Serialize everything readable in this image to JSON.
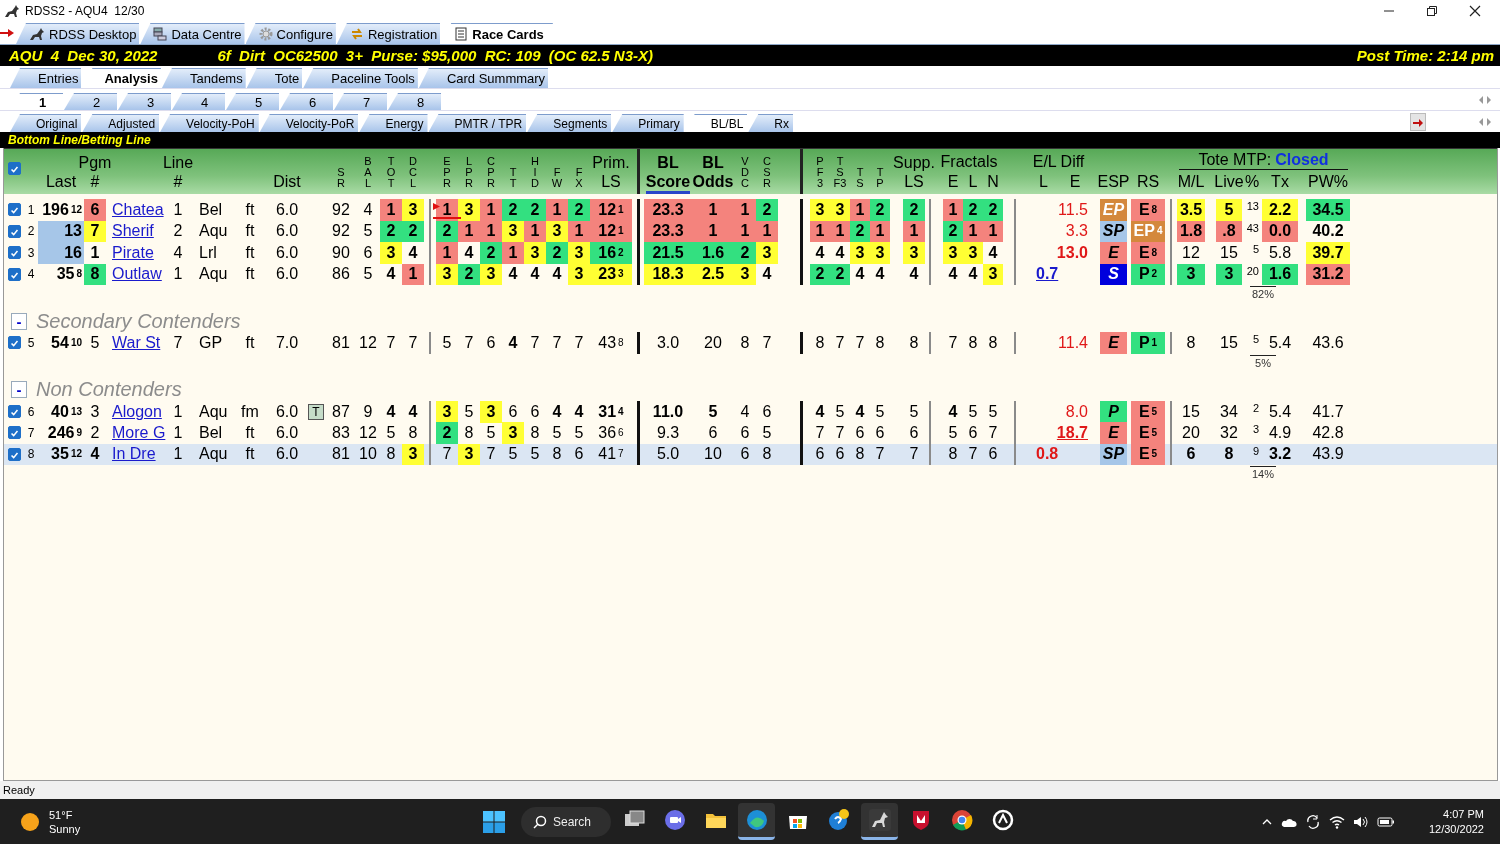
{
  "window": {
    "title": "RDSS2 - AQU4  12/30"
  },
  "app_tabs": [
    {
      "label": "RDSS Desktop",
      "selected": false
    },
    {
      "label": "Data Centre",
      "selected": false
    },
    {
      "label": "Configure",
      "selected": false
    },
    {
      "label": "Registration",
      "selected": false
    },
    {
      "label": "Race Cards",
      "selected": true
    }
  ],
  "race_bar": {
    "race": "AQU  4  Dec 30, 2022",
    "conditions": "6f  Dirt  OC62500  3+  Purse: $95,000  RC: 109  (OC 62.5 N3-X)",
    "post_time": "Post Time: 2:14 pm"
  },
  "view_tabs": [
    {
      "label": "Entries",
      "selected": false
    },
    {
      "label": "Analysis",
      "selected": true
    },
    {
      "label": "Tandems",
      "selected": false
    },
    {
      "label": "Tote",
      "selected": false
    },
    {
      "label": "Paceline Tools",
      "selected": false
    },
    {
      "label": "Card Summmary",
      "selected": false
    }
  ],
  "race_tabs": [
    {
      "label": "1",
      "selected": true
    },
    {
      "label": "2",
      "selected": false
    },
    {
      "label": "3",
      "selected": false
    },
    {
      "label": "4",
      "selected": false
    },
    {
      "label": "5",
      "selected": false
    },
    {
      "label": "6",
      "selected": false
    },
    {
      "label": "7",
      "selected": false
    },
    {
      "label": "8",
      "selected": false
    }
  ],
  "report_tabs": [
    {
      "label": "Original",
      "selected": false
    },
    {
      "label": "Adjusted",
      "selected": false
    },
    {
      "label": "Velocity-PoH",
      "selected": false
    },
    {
      "label": "Velocity-PoR",
      "selected": false
    },
    {
      "label": "Energy",
      "selected": false
    },
    {
      "label": "PMTR / TPR",
      "selected": false
    },
    {
      "label": "Segments",
      "selected": false
    },
    {
      "label": "Primary",
      "selected": false
    },
    {
      "label": "BL/BL",
      "selected": true
    },
    {
      "label": "Rx",
      "selected": false
    }
  ],
  "caption": "Bottom Line/Betting Line",
  "table": {
    "header": {
      "checked": true,
      "columns": [
        null,
        {
          "label": "Last",
          "sorted": false
        },
        {
          "label": "Pgm\n#",
          "sorted": false
        },
        null,
        {
          "label": "Line\n#",
          "sorted": false
        },
        null,
        null,
        {
          "label": "Dist",
          "sorted": false
        },
        null,
        {
          "label": "S\nR",
          "sorted": false
        },
        {
          "label": "B\nA\nL",
          "sorted": false
        },
        {
          "label": "T\nO\nT",
          "sorted": false
        },
        {
          "label": "D\nC\nL",
          "sorted": false
        },
        {
          "label": "E\nP\nR",
          "sorted": false
        },
        {
          "label": "L\nP\nR",
          "sorted": false
        },
        {
          "label": "C\nP\nR",
          "sorted": false
        },
        {
          "label": "T\nT",
          "sorted": false
        },
        {
          "label": "H\nI\nD",
          "sorted": false
        },
        {
          "label": "F\nW",
          "sorted": false
        },
        {
          "label": "F\nX",
          "sorted": false
        },
        {
          "label": "Prim.\nLS",
          "sorted": false
        },
        {
          "label": "BL\nScore",
          "sorted": true,
          "bold": true
        },
        {
          "label": "BL\nOdds",
          "sorted": false,
          "bold": true
        },
        {
          "label": "V\nD\nC",
          "sorted": false
        },
        {
          "label": "C\nS\nR",
          "sorted": false
        },
        {
          "label": "P\nF\n3",
          "sorted": false
        },
        {
          "label": "T\nS\nF3",
          "sorted": false
        },
        {
          "label": "T\nS",
          "sorted": false
        },
        {
          "label": "T\nP",
          "sorted": false
        },
        {
          "label": "Supp.\nLS",
          "sorted": false
        },
        {
          "label": "E",
          "sorted": false
        },
        {
          "label": "L",
          "sorted": false
        },
        {
          "label": "N",
          "sorted": false
        },
        {
          "label": "L",
          "sorted": false
        },
        {
          "label": "E",
          "sorted": false
        },
        {
          "label": "ESP",
          "sorted": false
        },
        {
          "label": "RS",
          "sorted": false
        },
        {
          "label": "M/L",
          "sorted": false
        },
        {
          "label": "Live",
          "sorted": false
        },
        {
          "label": "%",
          "sorted": false
        },
        {
          "label": "Tx",
          "sorted": false
        },
        {
          "label": "PW%",
          "sorted": false
        }
      ],
      "groups": [
        {
          "label": "Fractals"
        },
        {
          "label": "E/L Diff"
        },
        {
          "label": "Tote MTP:",
          "status": "Closed"
        }
      ]
    },
    "groups": [
      {
        "total": "82%",
        "rows": [
          {
            "checked": true,
            "selected": false,
            "bold": true,
            "cells": [
              "1",
              {
                "text": "196",
                "sup": "12"
              },
              {
                "text": "6",
                "color": "#f4837d"
              },
              "Chatea",
              "1",
              "Bel",
              "ft",
              "6.0",
              null,
              "92",
              "4",
              {
                "text": "1",
                "color": "#f4837d"
              },
              {
                "text": "3",
                "color": "#ffff33"
              },
              {
                "text": "1",
                "color": "#f4837d",
                "flagged": true
              },
              {
                "text": "3",
                "color": "#ffff33"
              },
              {
                "text": "1",
                "color": "#f4837d"
              },
              {
                "text": "2",
                "color": "#33e080"
              },
              {
                "text": "2",
                "color": "#33e080"
              },
              {
                "text": "1",
                "color": "#f4837d"
              },
              {
                "text": "2",
                "color": "#33e080"
              },
              {
                "text": "12",
                "sup": "1",
                "color": "#f4837d"
              },
              {
                "text": "23.3",
                "color": "#f4837d"
              },
              {
                "text": "1",
                "color": "#f4837d"
              },
              {
                "text": "1",
                "color": "#f4837d"
              },
              {
                "text": "2",
                "color": "#33e080"
              },
              {
                "text": "3",
                "color": "#ffff33"
              },
              {
                "text": "3",
                "color": "#ffff33"
              },
              {
                "text": "1",
                "color": "#f4837d"
              },
              {
                "text": "2",
                "color": "#33e080"
              },
              {
                "text": "2",
                "color": "#33e080"
              },
              {
                "text": "1",
                "color": "#f4837d"
              },
              {
                "text": "2",
                "color": "#33e080"
              },
              {
                "text": "2",
                "color": "#33e080"
              },
              null,
              {
                "text": "11.5",
                "kind": "warn",
                "bold": false
              },
              {
                "text": "EP",
                "color": "#d4883c"
              },
              {
                "text": "E",
                "sup": "8",
                "color": "#f4837d"
              },
              {
                "text": "3.5",
                "color": "#ffff33"
              },
              {
                "text": "5",
                "color": "#ffff33"
              },
              "13",
              {
                "text": "2.2",
                "color": "#ffff33"
              },
              {
                "text": "34.5",
                "color": "#33e080"
              }
            ]
          },
          {
            "checked": true,
            "selected": false,
            "bold": true,
            "cells": [
              "2",
              {
                "text": "13",
                "color": "#a6c6e8"
              },
              {
                "text": "7",
                "color": "#ffff33"
              },
              "Sherif",
              "2",
              "Aqu",
              "ft",
              "6.0",
              null,
              "92",
              "5",
              {
                "text": "2",
                "color": "#33e080"
              },
              {
                "text": "2",
                "color": "#33e080"
              },
              {
                "text": "2",
                "color": "#33e080"
              },
              {
                "text": "1",
                "color": "#f4837d"
              },
              {
                "text": "1",
                "color": "#f4837d"
              },
              {
                "text": "3",
                "color": "#ffff33"
              },
              {
                "text": "1",
                "color": "#f4837d"
              },
              {
                "text": "3",
                "color": "#ffff33"
              },
              {
                "text": "1",
                "color": "#f4837d"
              },
              {
                "text": "12",
                "sup": "1",
                "color": "#f4837d"
              },
              {
                "text": "23.3",
                "color": "#f4837d"
              },
              {
                "text": "1",
                "color": "#f4837d"
              },
              {
                "text": "1",
                "color": "#f4837d"
              },
              {
                "text": "1",
                "color": "#f4837d"
              },
              {
                "text": "1",
                "color": "#f4837d"
              },
              {
                "text": "1",
                "color": "#f4837d"
              },
              {
                "text": "2",
                "color": "#33e080"
              },
              {
                "text": "1",
                "color": "#f4837d"
              },
              {
                "text": "1",
                "color": "#f4837d"
              },
              {
                "text": "2",
                "color": "#33e080"
              },
              {
                "text": "1",
                "color": "#f4837d"
              },
              {
                "text": "1",
                "color": "#f4837d"
              },
              null,
              {
                "text": "3.3",
                "kind": "warn",
                "bold": false
              },
              {
                "text": "SP",
                "color": "#a6c6e8"
              },
              {
                "text": "EP",
                "sup": "4",
                "color": "#d4883c"
              },
              {
                "text": "1.8",
                "color": "#f4837d"
              },
              {
                "text": ".8",
                "color": "#f4837d"
              },
              "43",
              {
                "text": "0.0",
                "color": "#f4837d"
              },
              "40.2"
            ]
          },
          {
            "checked": true,
            "selected": false,
            "bold": true,
            "cells": [
              "3",
              {
                "text": "16",
                "color": "#a6c6e8"
              },
              "1",
              "Pirate",
              "4",
              "Lrl",
              "ft",
              "6.0",
              null,
              "90",
              "6",
              {
                "text": "3",
                "color": "#ffff33"
              },
              "4",
              {
                "text": "1",
                "color": "#f4837d"
              },
              "4",
              {
                "text": "2",
                "color": "#33e080"
              },
              {
                "text": "1",
                "color": "#f4837d"
              },
              {
                "text": "3",
                "color": "#ffff33"
              },
              {
                "text": "2",
                "color": "#33e080"
              },
              {
                "text": "3",
                "color": "#ffff33"
              },
              {
                "text": "16",
                "sup": "2",
                "color": "#33e080"
              },
              {
                "text": "21.5",
                "color": "#33e080"
              },
              {
                "text": "1.6",
                "color": "#33e080"
              },
              {
                "text": "2",
                "color": "#33e080"
              },
              {
                "text": "3",
                "color": "#ffff33"
              },
              "4",
              "4",
              {
                "text": "3",
                "color": "#ffff33"
              },
              {
                "text": "3",
                "color": "#ffff33"
              },
              {
                "text": "3",
                "color": "#ffff33"
              },
              {
                "text": "3",
                "color": "#ffff33"
              },
              {
                "text": "3",
                "color": "#ffff33"
              },
              "4",
              null,
              {
                "text": "13.0",
                "kind": "warn"
              },
              {
                "text": "E",
                "color": "#f4837d"
              },
              {
                "text": "E",
                "sup": "8",
                "color": "#f4837d"
              },
              {
                "text": "12",
                "bold": false
              },
              {
                "text": "15",
                "bold": false
              },
              "5",
              {
                "text": "5.8",
                "bold": false
              },
              {
                "text": "39.7",
                "color": "#ffff33"
              }
            ]
          },
          {
            "checked": true,
            "selected": false,
            "bold": true,
            "cells": [
              "4",
              {
                "text": "35",
                "sup": "8"
              },
              {
                "text": "8",
                "color": "#33e080"
              },
              "Outlaw",
              "1",
              "Aqu",
              "ft",
              "6.0",
              null,
              "86",
              "5",
              "4",
              {
                "text": "1",
                "color": "#f4837d"
              },
              {
                "text": "3",
                "color": "#ffff33"
              },
              {
                "text": "2",
                "color": "#33e080"
              },
              {
                "text": "3",
                "color": "#ffff33"
              },
              "4",
              "4",
              "4",
              {
                "text": "3",
                "color": "#ffff33"
              },
              {
                "text": "23",
                "sup": "3",
                "color": "#ffff33"
              },
              {
                "text": "18.3",
                "color": "#ffff33"
              },
              {
                "text": "2.5",
                "color": "#ffff33"
              },
              {
                "text": "3",
                "color": "#ffff33"
              },
              "4",
              {
                "text": "2",
                "color": "#33e080"
              },
              {
                "text": "2",
                "color": "#33e080"
              },
              "4",
              "4",
              "4",
              "4",
              "4",
              {
                "text": "3",
                "color": "#ffff33"
              },
              {
                "text": "0.7",
                "kind": "link"
              },
              null,
              {
                "text": "S",
                "color": "#0000dd"
              },
              {
                "text": "P",
                "sup": "2",
                "color": "#33e080"
              },
              {
                "text": "3",
                "color": "#33e080"
              },
              {
                "text": "3",
                "color": "#33e080"
              },
              "20",
              {
                "text": "1.6",
                "color": "#33e080"
              },
              {
                "text": "31.2",
                "color": "#f4837d"
              }
            ]
          }
        ]
      },
      {
        "toggle": "-",
        "title": "Secondary Contenders",
        "total": "5%",
        "rows": [
          {
            "checked": true,
            "selected": false,
            "bold": false,
            "cells": [
              "5",
              {
                "text": "54",
                "sup": "10"
              },
              "5",
              "War St",
              "7",
              "GP",
              "ft",
              "7.0",
              null,
              "81",
              "12",
              "7",
              "7",
              "5",
              "7",
              "6",
              {
                "text": "4",
                "bold": true
              },
              "7",
              "7",
              "7",
              {
                "text": "43",
                "sup": "8"
              },
              "3.0",
              "20",
              "8",
              "7",
              "8",
              "7",
              "7",
              "8",
              "8",
              "7",
              "8",
              "8",
              null,
              {
                "text": "11.4",
                "kind": "warn"
              },
              {
                "text": "E",
                "color": "#f4837d"
              },
              {
                "text": "P",
                "sup": "1",
                "color": "#33e080"
              },
              "8",
              "15",
              "5",
              "5.4",
              "43.6"
            ]
          }
        ]
      },
      {
        "toggle": "-",
        "title": "Non Contenders",
        "total": "14%",
        "rows": [
          {
            "checked": true,
            "selected": false,
            "bold": false,
            "cells": [
              "6",
              {
                "text": "40",
                "sup": "13"
              },
              "3",
              "Alogon",
              "1",
              "Aqu",
              "fm",
              "6.0",
              "T",
              "87",
              "9",
              {
                "text": "4",
                "bold": true
              },
              {
                "text": "4",
                "bold": true
              },
              {
                "text": "3",
                "color": "#ffff33"
              },
              "5",
              {
                "text": "3",
                "color": "#ffff33"
              },
              "6",
              "6",
              {
                "text": "4",
                "bold": true
              },
              {
                "text": "4",
                "bold": true
              },
              {
                "text": "31",
                "sup": "4",
                "bold": true
              },
              {
                "text": "11.0",
                "bold": true
              },
              {
                "text": "5",
                "bold": true
              },
              "4",
              "6",
              {
                "text": "4",
                "bold": true
              },
              "5",
              {
                "text": "4",
                "bold": true
              },
              "5",
              "5",
              {
                "text": "4",
                "bold": true
              },
              "5",
              "5",
              null,
              {
                "text": "8.0",
                "kind": "warn"
              },
              {
                "text": "P",
                "color": "#33e080"
              },
              {
                "text": "E",
                "sup": "5",
                "color": "#f4837d"
              },
              "15",
              "34",
              "2",
              "5.4",
              "41.7"
            ]
          },
          {
            "checked": true,
            "selected": false,
            "bold": false,
            "cells": [
              "7",
              {
                "text": "246",
                "sup": "9"
              },
              "2",
              "More G",
              "1",
              "Bel",
              "ft",
              "6.0",
              null,
              "83",
              "12",
              "5",
              "8",
              {
                "text": "2",
                "color": "#33e080"
              },
              "8",
              "5",
              {
                "text": "3",
                "color": "#ffff33"
              },
              "8",
              "5",
              "5",
              {
                "text": "36",
                "sup": "6"
              },
              "9.3",
              "6",
              "6",
              "5",
              "7",
              "7",
              "6",
              "6",
              "6",
              "5",
              "6",
              "7",
              null,
              {
                "text": "18.7",
                "kind": "warn",
                "underline": true,
                "bold": true
              },
              {
                "text": "E",
                "color": "#f4837d"
              },
              {
                "text": "E",
                "sup": "5",
                "color": "#f4837d"
              },
              "20",
              "32",
              "3",
              "4.9",
              "42.8"
            ]
          },
          {
            "checked": true,
            "selected": true,
            "bold": false,
            "cells": [
              "8",
              {
                "text": "35",
                "sup": "12"
              },
              {
                "text": "4",
                "bold": true
              },
              "In Dre",
              "1",
              "Aqu",
              "ft",
              "6.0",
              null,
              "81",
              "10",
              "8",
              {
                "text": "3",
                "color": "#ffff33"
              },
              "7",
              {
                "text": "3",
                "color": "#ffff33"
              },
              "7",
              "5",
              "5",
              "8",
              "6",
              {
                "text": "41",
                "sup": "7"
              },
              "5.0",
              "10",
              "6",
              "8",
              "6",
              "6",
              "8",
              "7",
              "7",
              "8",
              "7",
              "6",
              {
                "text": "0.8",
                "kind": "warn",
                "bold": true
              },
              null,
              {
                "text": "SP",
                "color": "#a6c6e8"
              },
              {
                "text": "E",
                "sup": "5",
                "color": "#f4837d"
              },
              {
                "text": "6",
                "bold": true
              },
              {
                "text": "8",
                "bold": true
              },
              "9",
              {
                "text": "3.2",
                "bold": true
              },
              "43.9"
            ]
          }
        ]
      }
    ]
  },
  "status_bar": "Ready",
  "taskbar": {
    "weather": {
      "temperature": "51°F",
      "condition": "Sunny"
    },
    "search": "Search",
    "apps": [
      {
        "active": false
      },
      {
        "active": false
      },
      {
        "active": false
      },
      {
        "active": true
      },
      {
        "active": false
      },
      {
        "active": false
      },
      {
        "active": true
      },
      {
        "active": false
      },
      {
        "active": false
      },
      {
        "active": false
      }
    ],
    "clock": {
      "time": "4:07 PM",
      "date": "12/30/2022"
    }
  }
}
